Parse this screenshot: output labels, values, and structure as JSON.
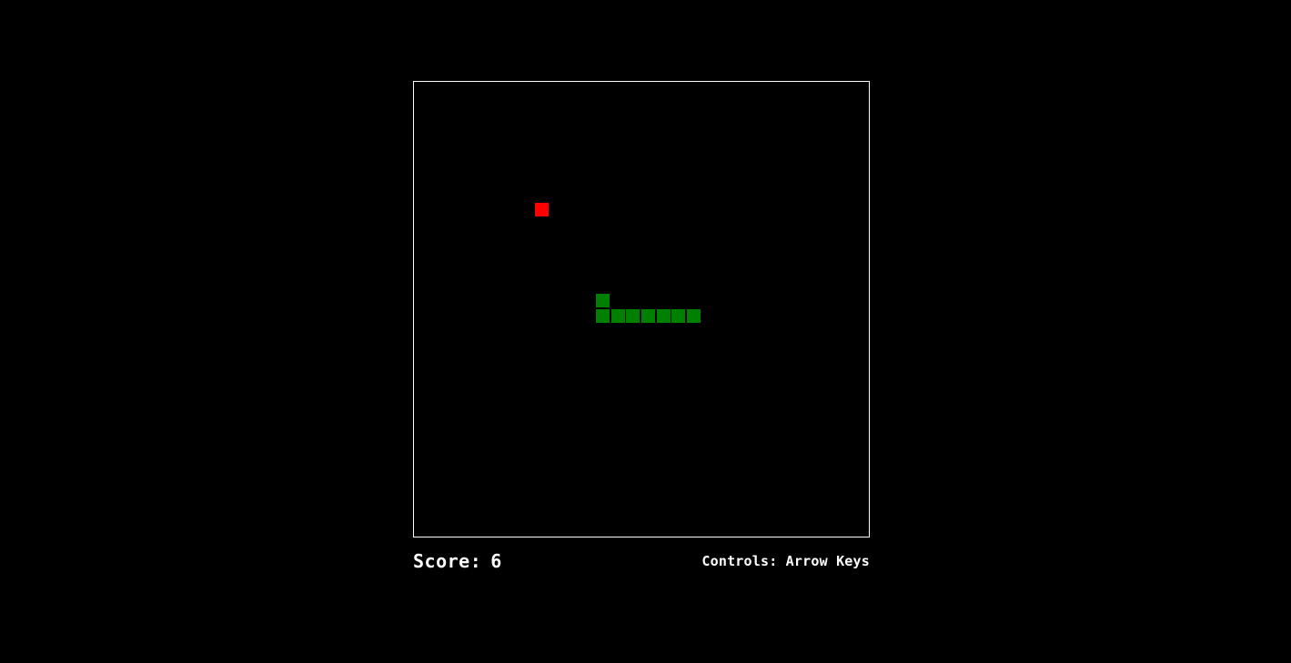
{
  "game": {
    "grid_cell_size_units": 1,
    "food": {
      "col": 8,
      "row": 8,
      "color": "#ff0000"
    },
    "snake": {
      "color": "#008000",
      "segments": [
        {
          "col": 12,
          "row": 14
        },
        {
          "col": 12,
          "row": 15
        },
        {
          "col": 13,
          "row": 15
        },
        {
          "col": 14,
          "row": 15
        },
        {
          "col": 15,
          "row": 15
        },
        {
          "col": 16,
          "row": 15
        },
        {
          "col": 17,
          "row": 15
        },
        {
          "col": 18,
          "row": 15
        }
      ]
    },
    "board_border_color": "#ffffff"
  },
  "hud": {
    "score_label": "Score:",
    "score_value": "6",
    "controls_text": "Controls: Arrow Keys"
  }
}
